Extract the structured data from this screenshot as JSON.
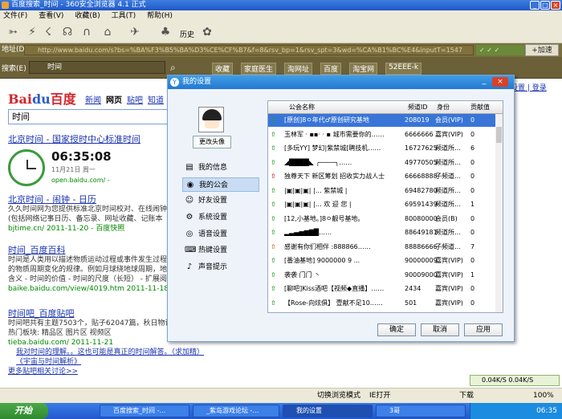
{
  "window": {
    "title": "百度搜索_时间 - 360安全浏览器 4.1 正式"
  },
  "menu": [
    "文件(F)",
    "查看(V)",
    "收藏(B)",
    "工具(T)",
    "帮助(H)"
  ],
  "toolbar": {
    "history_label": "历史"
  },
  "address": {
    "label": "地址(D)",
    "url": "http://www.baidu.com/s?bs=%BA%F3%B5%BA%D3%CE%CF%B7&f=8&rsv_bp=1&rsv_spt=3&wd=%CA%B1%BC%E4&inputT=1547",
    "add_label": "+加速"
  },
  "search": {
    "label": "搜索(E)",
    "query": "时间"
  },
  "favorites": [
    "收藏",
    "家庭医生",
    "淘网址",
    "百度",
    "淘宝网",
    "52EEE-k"
  ],
  "baidu": {
    "logo_a": "Bai",
    "logo_b": "du",
    "logo_c": "百度",
    "nav": [
      "新闻",
      "网页",
      "贴吧",
      "知道"
    ],
    "query": "时间",
    "right_links": "设置 | 登录",
    "r1_title": "北京时间 - 国家授时中心标准时间",
    "r1_time": "06:35:08",
    "r1_date": "11月21日  周一",
    "r1_url": "open.baidu.com/ -",
    "r2_title": "北京时间 - 闹钟 - 日历",
    "r2_l1": "久久时间网为您提供标准北京时间校对、在线闹钟",
    "r2_l2": "(包括网络记事日历、备忘录、网址收藏、记账本",
    "r2_url": "bjtime.cn/ 2011-11-20 - 百度快照",
    "r3_title": "时间_百度百科",
    "r3_l1": "时间是人类用以描述物质运动过程或事件发生过程",
    "r3_l2": "的物质周期变化的规律。例如月球绕地球周期，地",
    "r3_l3": "含义 - 时间的价值 - 时间的尺度（长短） - 扩展阅",
    "r3_url": "baike.baidu.com/view/4019.htm 2011-11-18",
    "r4_title": "时间吧_百度贴吧",
    "r4_l1": "时间吧共有主题7503个，贴子62047篇，秋日物语",
    "r4_l2": "热门板块: 精品区  图片区  视频区",
    "r4_url": "tieba.baidu.com/ 2011-11-21",
    "r4_l3": "我对时间的理解。。这也可能是真正的时间解答。（求加精）",
    "r4_l4": "《宇宙与时间解析》",
    "r4_l5": "更多贴吧相关讨论>>"
  },
  "dialog": {
    "title": "我的设置",
    "change_avatar": "更改头像",
    "nav": [
      "我的信息",
      "我的公会",
      "好友设置",
      "系统设置",
      "语音设置",
      "热键设置",
      "声音提示"
    ],
    "columns": [
      "公会名称",
      "频道ID",
      "身份",
      "贡献值"
    ],
    "rows": [
      {
        "name": "[原创]8ㅇ年代♂原创研究基地",
        "id": "208019",
        "role": "会员(VIP)",
        "score": "0"
      },
      {
        "name": "玉林军  ·  ▪▪·  ·  ▪ 城市需要你的……",
        "id": "6666666",
        "role": "嘉宾(VIP)",
        "score": "0"
      },
      {
        "name": "[多玩YY] 梦幻|紫禁城[聘技机……",
        "id": "16727625",
        "role": "频道所…",
        "score": "6"
      },
      {
        "name": "◢████◣  ╭────╮……",
        "id": "49770505",
        "role": "频道所…",
        "score": "0"
      },
      {
        "name": "独尊天下 新区筹划 招收实力战人士",
        "id": "66668888",
        "role": "子频道…",
        "score": "0"
      },
      {
        "name": "|▣|▣|▣|  |…  紫禁城 |",
        "id": "69482780",
        "role": "频道所…",
        "score": "0"
      },
      {
        "name": "|▣|▣|▣|  |…  欢 迎 您 |",
        "id": "69591439",
        "role": "频道所…",
        "score": "1"
      },
      {
        "name": "[12,小基地。]8ㅇ靓号基地。",
        "id": "80080000",
        "role": "会员(B)",
        "score": "0"
      },
      {
        "name": "▂▃▄▅▆▇█……",
        "id": "88649181",
        "role": "频道所…",
        "score": "0"
      },
      {
        "name": "感谢有你们相伴 :888866……",
        "id": "88886666",
        "role": "子频道…",
        "score": "7"
      },
      {
        "name": "[番油基地] 9000000 9 ...",
        "id": "90000009",
        "role": "嘉宾(VIP)",
        "score": "0"
      },
      {
        "name": "袭袭  门门  丶",
        "id": "90009000",
        "role": "嘉宾(VIP)",
        "score": "1"
      },
      {
        "name": "[聊吧]Kiss酒吧【视频◆直播】……",
        "id": "2434",
        "role": "嘉宾(VIP)",
        "score": "0"
      },
      {
        "name": "【Rose-向炫俱】 壹献不足10……",
        "id": "501",
        "role": "嘉宾(VIP)",
        "score": "0"
      }
    ],
    "ok": "确定",
    "cancel": "取消",
    "apply": "应用"
  },
  "status": {
    "mode": "切换浏览模式",
    "ie": "IE打开",
    "download": "下载",
    "zoom": "100%"
  },
  "speed": "0.04K/S  0.04K/S",
  "taskbar": {
    "start": "开始",
    "tasks": [
      "百度搜索_时间 -…",
      "_紫岛游戏论坛 -…",
      "我的设置",
      "3哥"
    ],
    "clock": "06:35"
  }
}
